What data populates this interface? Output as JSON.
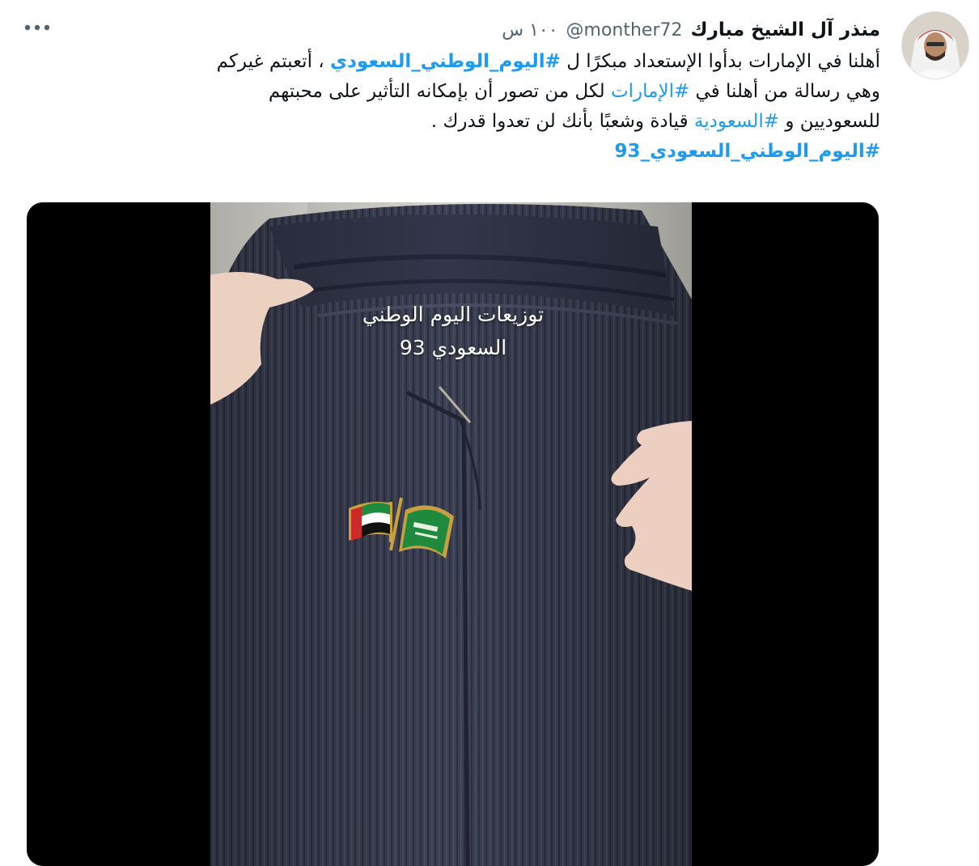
{
  "author": {
    "display_name": "منذر آل الشيخ مبارك",
    "handle": "@monther72",
    "time": "١٠٠ س",
    "avatar_icon": "user-avatar"
  },
  "menu": {
    "more_icon": "more-horizontal-icon"
  },
  "tweet": {
    "line1": {
      "a": "أهلنا في الإمارات بدأوا الإستعداد مبكرًا ل ",
      "hashtag": "#اليوم_الوطني_السعودي",
      "b": " ، أتعبتم غيركم"
    },
    "line2": {
      "a": "وهي رسالة من أهلنا في ",
      "hashtag": "#الإمارات",
      "b": " لكل من تصور أن بإمكانه التأثير على محبتهم"
    },
    "line3": {
      "a": "للسعوديين و ",
      "hashtag": "#السعودية",
      "b": " قيادة وشعبًا بأنك لن تعدوا قدرك ."
    },
    "line4": {
      "hashtag": "#اليوم_الوطني_السعودي_93"
    }
  },
  "media": {
    "caption_line1": "توزيعات اليوم الوطني",
    "caption_line2": "السعودي 93"
  },
  "colors": {
    "link": "#1d9bf0",
    "secondary": "#536471",
    "text": "#0f1419"
  }
}
